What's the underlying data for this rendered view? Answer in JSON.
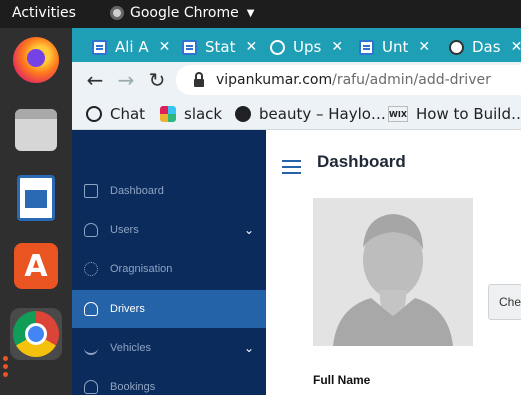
{
  "topbar": {
    "activities": "Activities",
    "app_name": "Google Chrome"
  },
  "dock": {
    "apps": [
      "firefox-icon",
      "files-icon",
      "libreoffice-writer-icon",
      "app-center-icon",
      "chrome-icon"
    ]
  },
  "browser": {
    "tabs": [
      {
        "label": "Ali A",
        "favicon": "docs-icon"
      },
      {
        "label": "Stat",
        "favicon": "docs-icon"
      },
      {
        "label": "Ups",
        "favicon": "chatgpt-icon"
      },
      {
        "label": "Unt",
        "favicon": "docs-icon"
      },
      {
        "label": "Das",
        "favicon": "globe-icon"
      }
    ],
    "url_host": "vipankumar.com",
    "url_path": "/rafu/admin/add-driver",
    "bookmarks": [
      {
        "label": "Chat",
        "icon": "chat-icon"
      },
      {
        "label": "slack",
        "icon": "slack-icon"
      },
      {
        "label": "beauty – Haylo…",
        "icon": "globe-icon"
      },
      {
        "label": "How to Build…",
        "icon": "wix-icon"
      }
    ]
  },
  "sidebar": {
    "items": [
      {
        "label": "Dashboard",
        "icon": "dashboard-icon",
        "has_submenu": false,
        "active": false
      },
      {
        "label": "Users",
        "icon": "users-icon",
        "has_submenu": true,
        "active": false
      },
      {
        "label": "Oragnisation",
        "icon": "organisation-icon",
        "has_submenu": false,
        "active": false
      },
      {
        "label": "Drivers",
        "icon": "drivers-icon",
        "has_submenu": false,
        "active": true
      },
      {
        "label": "Vehicles",
        "icon": "vehicles-icon",
        "has_submenu": true,
        "active": false
      },
      {
        "label": "Bookings",
        "icon": "bookings-icon",
        "has_submenu": false,
        "active": false
      }
    ]
  },
  "main": {
    "title": "Dashboard",
    "form": {
      "avatar_icon": "profile-placeholder-icon",
      "full_name_label": "Full Name",
      "choose_button": "Che"
    }
  },
  "colors": {
    "sidebar_bg": "#0a2b5c",
    "active_item": "#2563a8",
    "tab_strip": "#1f9fb6"
  }
}
